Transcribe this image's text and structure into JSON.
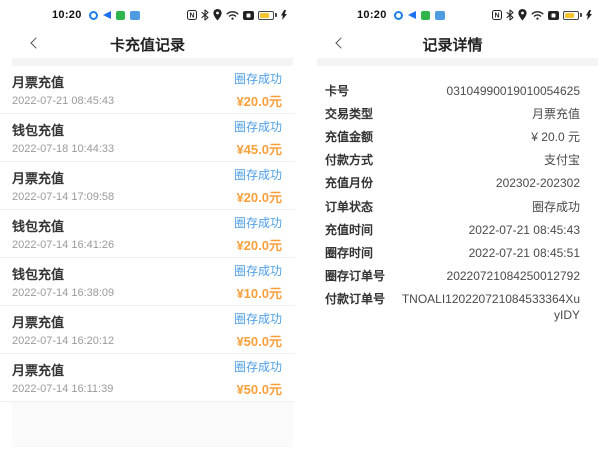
{
  "colors": {
    "status_blue": "#4fa0e5",
    "amount_orange": "#f8a03c"
  },
  "left_screen": {
    "status_bar": {
      "time": "10:20",
      "icons": [
        "notification-circle",
        "share-triangle",
        "green-app",
        "blue-app",
        "nfc",
        "bluetooth",
        "location",
        "wifi",
        "screen-record",
        "battery",
        "charging-bolt"
      ]
    },
    "nav": {
      "title": "卡充值记录"
    },
    "records": [
      {
        "type": "月票充值",
        "datetime": "2022-07-21 08:45:43",
        "status": "圈存成功",
        "amount": "¥20.0元"
      },
      {
        "type": "钱包充值",
        "datetime": "2022-07-18 10:44:33",
        "status": "圈存成功",
        "amount": "¥45.0元"
      },
      {
        "type": "月票充值",
        "datetime": "2022-07-14 17:09:58",
        "status": "圈存成功",
        "amount": "¥20.0元"
      },
      {
        "type": "钱包充值",
        "datetime": "2022-07-14 16:41:26",
        "status": "圈存成功",
        "amount": "¥20.0元"
      },
      {
        "type": "钱包充值",
        "datetime": "2022-07-14 16:38:09",
        "status": "圈存成功",
        "amount": "¥10.0元"
      },
      {
        "type": "月票充值",
        "datetime": "2022-07-14 16:20:12",
        "status": "圈存成功",
        "amount": "¥50.0元"
      },
      {
        "type": "月票充值",
        "datetime": "2022-07-14 16:11:39",
        "status": "圈存成功",
        "amount": "¥50.0元"
      }
    ]
  },
  "right_screen": {
    "status_bar": {
      "time": "10:20",
      "icons": [
        "notification-circle",
        "share-triangle",
        "green-app",
        "blue-app",
        "nfc",
        "bluetooth",
        "location",
        "wifi",
        "screen-record",
        "battery",
        "charging-bolt"
      ]
    },
    "nav": {
      "title": "记录详情"
    },
    "details": [
      {
        "label": "卡号",
        "value": "03104990019010054625"
      },
      {
        "label": "交易类型",
        "value": "月票充值"
      },
      {
        "label": "充值金额",
        "value": "¥ 20.0 元"
      },
      {
        "label": "付款方式",
        "value": "支付宝"
      },
      {
        "label": "充值月份",
        "value": "202302-202302"
      },
      {
        "label": "订单状态",
        "value": "圈存成功"
      },
      {
        "label": "充值时间",
        "value": "2022-07-21 08:45:43"
      },
      {
        "label": "圈存时间",
        "value": "2022-07-21 08:45:51"
      },
      {
        "label": "圈存订单号",
        "value": "20220721084250012792"
      },
      {
        "label": "付款订单号",
        "value": "TNOALI120220721084533364XuyIDY"
      }
    ]
  }
}
